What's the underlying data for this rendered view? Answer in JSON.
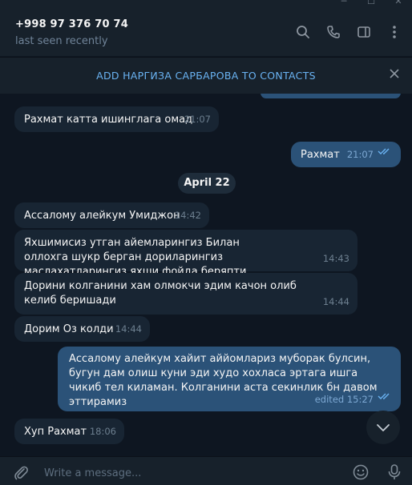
{
  "header": {
    "title": "+998 97 376 70 74",
    "status": "last seen recently"
  },
  "add_contact_bar": {
    "label": "ADD НАРГИЗА САРБАРОВА TO CONTACTS"
  },
  "date_separator": "April 22",
  "messages": [
    {
      "direction": "in",
      "text": "Рахмат катта ишинглага омад",
      "time": "21:07"
    },
    {
      "direction": "out",
      "text": "Рахмат",
      "time": "21:07",
      "read": true
    },
    {
      "direction": "in",
      "text": "Ассалому алейкум Умиджон",
      "time": "14:42"
    },
    {
      "direction": "in",
      "text": "Яхшимисиз утган айемларингиз Билан оллохга шукр берган дориларингиз маслахатларингиз яхши фойда беряпти",
      "time": "14:43"
    },
    {
      "direction": "in",
      "text": "Дорини колганини хам олмокчи эдим качон олиб келиб беришади",
      "time": "14:44"
    },
    {
      "direction": "in",
      "text": "Дорим Оз колди",
      "time": "14:44"
    },
    {
      "direction": "out",
      "text": "Ассалому алейкум хайит аййомлариз муборак булсин, бугун дам олиш куни эди худо хохласа эртага ишга чикиб тел киламан. Колганини аста секинлик бн давом эттирамиз",
      "time": "edited 15:27",
      "read": true
    },
    {
      "direction": "in",
      "text": "Хуп Рахмат",
      "time": "18:06"
    }
  ],
  "composer": {
    "placeholder": "Write a message..."
  },
  "colors": {
    "background": "#0e1621",
    "panel": "#17212b",
    "incoming": "#182533",
    "outgoing": "#2b5278",
    "accent": "#6ab3f3"
  },
  "icons": [
    "minimize-icon",
    "maximize-icon",
    "close-window-icon",
    "search-icon",
    "phone-icon",
    "sidebar-toggle-icon",
    "more-vertical-icon",
    "close-icon",
    "chevron-down-icon",
    "attach-icon",
    "emoji-icon",
    "microphone-icon"
  ]
}
